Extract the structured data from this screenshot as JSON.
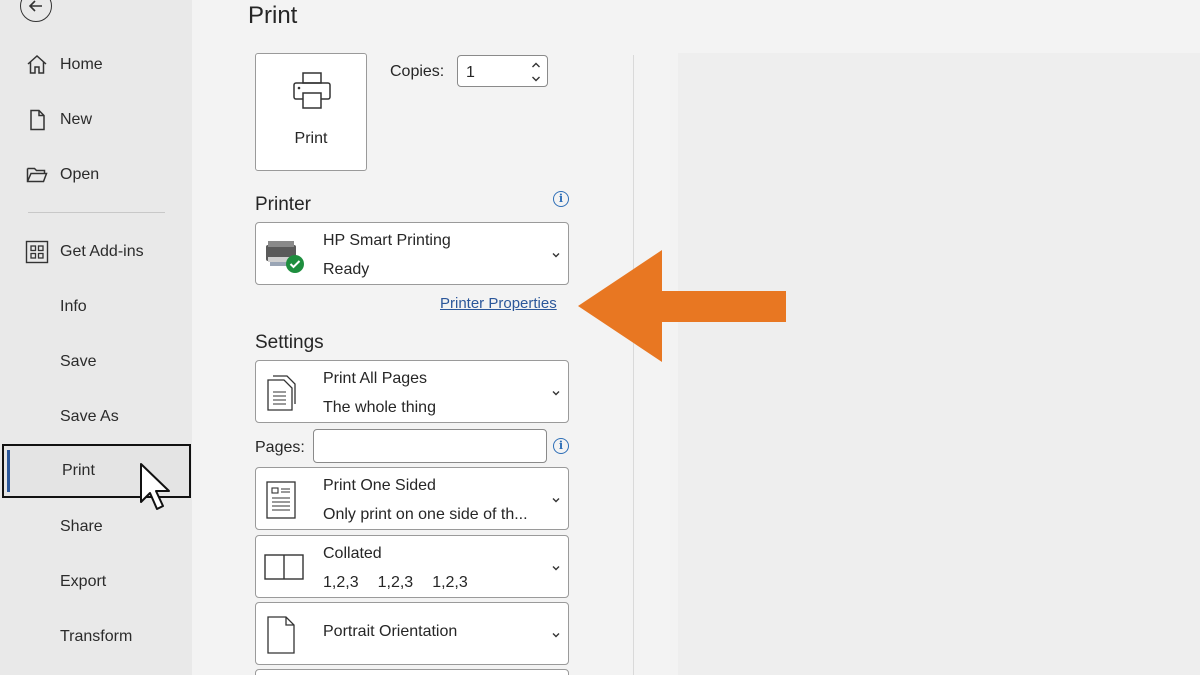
{
  "sidebar": {
    "items": [
      {
        "label": "Home",
        "icon": "home-icon"
      },
      {
        "label": "New",
        "icon": "new-document-icon"
      },
      {
        "label": "Open",
        "icon": "folder-open-icon"
      },
      {
        "label": "Get Add-ins",
        "icon": "add-ins-grid-icon"
      },
      {
        "label": "Info"
      },
      {
        "label": "Save"
      },
      {
        "label": "Save As"
      },
      {
        "label": "Print",
        "selected": true
      },
      {
        "label": "Share"
      },
      {
        "label": "Export"
      },
      {
        "label": "Transform"
      }
    ]
  },
  "print_panel": {
    "title": "Print",
    "print_button_label": "Print",
    "copies_label": "Copies:",
    "copies_value": "1",
    "printer_heading": "Printer",
    "printer": {
      "name": "HP Smart Printing",
      "status": "Ready"
    },
    "printer_properties_link": "Printer Properties",
    "settings_heading": "Settings",
    "pages_label": "Pages:",
    "pages_value": "",
    "settings": [
      {
        "line1": "Print All Pages",
        "line2": "The whole thing"
      },
      {
        "line1": "Print One Sided",
        "line2": "Only print on one side of th..."
      },
      {
        "line1": "Collated",
        "line2": [
          "1,2,3",
          "1,2,3",
          "1,2,3"
        ]
      },
      {
        "line1": "Portrait Orientation"
      }
    ]
  },
  "colors": {
    "accent_blue": "#2b579a",
    "arrow_orange": "#e87722",
    "ready_green": "#1e8e3e"
  }
}
